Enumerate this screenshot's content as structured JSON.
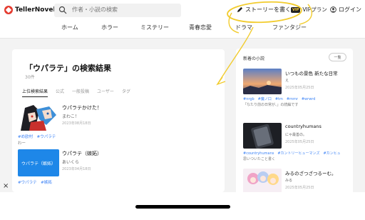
{
  "header": {
    "logo_text": "TellerNovel",
    "search_placeholder": "作者・小説の検索",
    "write_label": "ストーリーを書く",
    "vip_badge": "VIP",
    "vip_label": "VIPプラン",
    "login_label": "ログイン"
  },
  "nav": [
    "ホーム",
    "ホラー",
    "ミステリー",
    "青春恋愛",
    "ドラマ",
    "ファンタジー"
  ],
  "results": {
    "title": "「ウパラテ」の検索結果",
    "count": "30件",
    "tabs": [
      "上位検索結果",
      "公式",
      "一般投稿",
      "ユーザー",
      "タグ"
    ],
    "items": [
      {
        "title": "ウパラテかけた！",
        "author": "まわこ！",
        "date": "2023年08月18日",
        "tags": "#め欧村　#ウパラテ",
        "desc": "わー"
      },
      {
        "thumb_text": "ウパラテ（嫉妬）",
        "title": "ウパラテ（嫉妬）",
        "author": "あいくら",
        "date": "2023年04月18日",
        "tags": "#ウパラテ　#嫉妬",
        "desc": ""
      }
    ]
  },
  "sidebar": {
    "title": "新着の小説",
    "more_label": "一覧",
    "items": [
      {
        "title": "いつもの景色 新たな日常",
        "author": "え",
        "date": "2025年05月25日",
        "tags": "#nrgb　#魔ノ口　#tm　#mmr　#wrwrd",
        "desc": "「なたり前の日常が、」の続編です"
      },
      {
        "title": "countryhumans",
        "author": "にゃ最善の。",
        "date": "2025年05月25日",
        "tags": "#countryhumans　#カントリーヒューマンズ　#カンヒュ",
        "desc": "思いついたこと書く"
      },
      {
        "title": "みるのざつざつるーむ。",
        "author": "みる",
        "date": "2025年05月25日",
        "tags": "",
        "desc": ""
      }
    ]
  },
  "bottom": {
    "close": "×"
  },
  "colors": {
    "brand_red": "#e43b2f",
    "tag_blue": "#3b82f6",
    "highlight_yellow": "#f2cc2e"
  }
}
